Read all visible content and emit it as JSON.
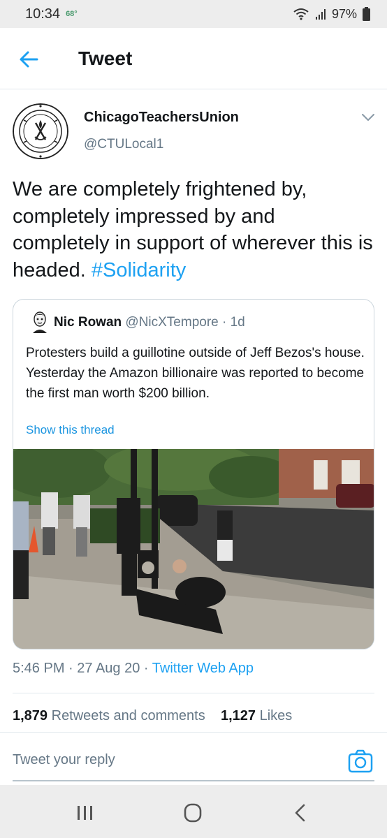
{
  "status_bar": {
    "time": "10:34",
    "temperature": "68°",
    "battery": "97%",
    "icons": [
      "wifi-icon",
      "signal-icon",
      "battery-icon"
    ]
  },
  "header": {
    "title": "Tweet",
    "back_icon": "back-arrow-icon"
  },
  "tweet": {
    "author_name": "ChicagoTeachersUnion",
    "author_handle": "@CTULocal1",
    "avatar_lettering": "CHICAGO TEACHERS UNION LOCAL 1",
    "text": "We are completely frightened by, completely impressed by and completely in support of wherever this is headed. ",
    "hashtag": "#Solidarity",
    "timestamp": "5:46 PM · 27 Aug 20 · ",
    "source": "Twitter Web App",
    "retweets_count": "1,879",
    "retweets_label": " Retweets and comments",
    "likes_count": "1,127",
    "likes_label": " Likes"
  },
  "quote": {
    "name": "Nic Rowan",
    "handle": "@NicXTempore · 1d",
    "text": "Protesters build a guillotine outside of Jeff Bezos's house. Yesterday the Amazon billionaire was reported to become the first man worth $200 billion.",
    "show_thread": "Show this thread"
  },
  "reply": {
    "placeholder": "Tweet your reply",
    "camera_icon": "camera-icon"
  },
  "colors": {
    "accent": "#1da1f2",
    "secondary_text": "#657786",
    "divider": "#e1e8ed"
  }
}
